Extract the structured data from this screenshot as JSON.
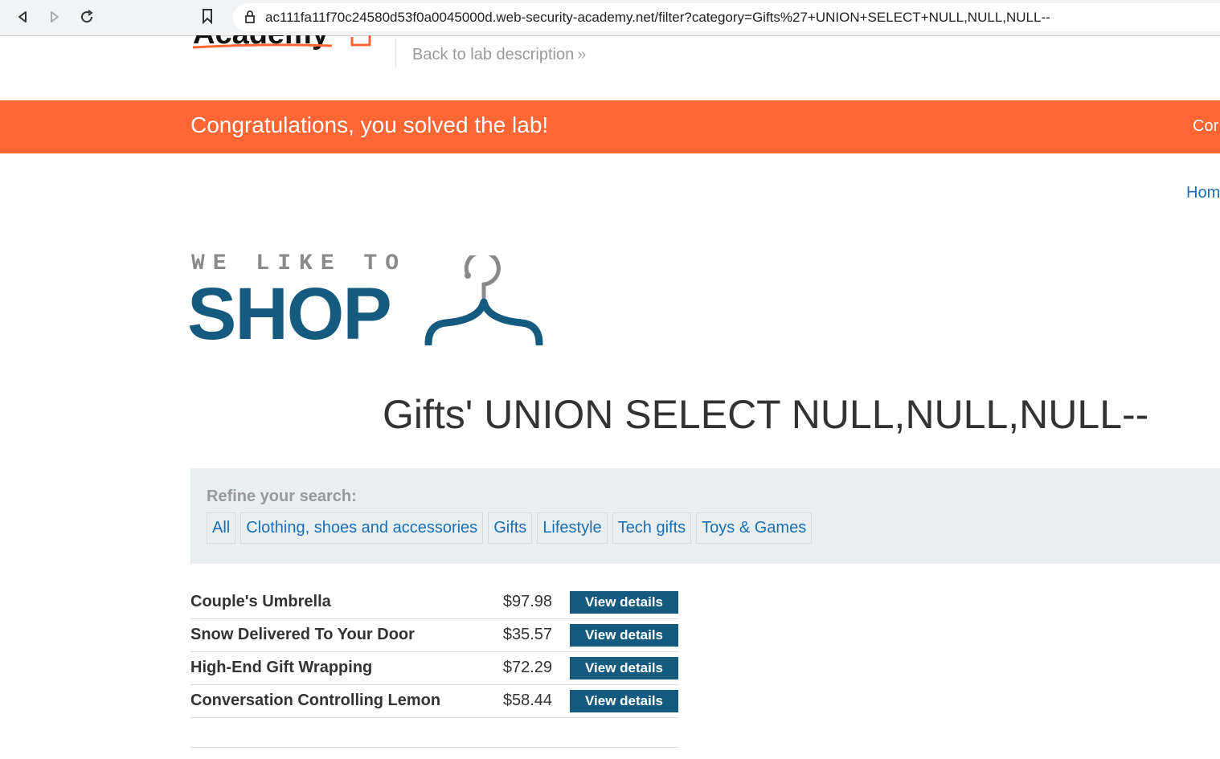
{
  "browser": {
    "url": "ac111fa11f70c24580d53f0a0045000d.web-security-academy.net/filter?category=Gifts%27+UNION+SELECT+NULL,NULL,NULL--"
  },
  "header": {
    "logo_text": "Academy",
    "back_link": "Back to lab description"
  },
  "banner": {
    "message": "Congratulations, you solved the lab!",
    "right_text": "Cor",
    "color": "#ff6633"
  },
  "nav": {
    "home": "Hom"
  },
  "shop_logo": {
    "tagline": "WE LIKE TO",
    "word": "SHOP"
  },
  "page_title": "Gifts' UNION SELECT NULL,NULL,NULL--",
  "filter": {
    "label": "Refine your search:",
    "categories": [
      "All",
      "Clothing, shoes and accessories",
      "Gifts",
      "Lifestyle",
      "Tech gifts",
      "Toys & Games"
    ]
  },
  "products": [
    {
      "name": "Couple's Umbrella",
      "price": "$97.98",
      "button": "View details"
    },
    {
      "name": "Snow Delivered To Your Door",
      "price": "$35.57",
      "button": "View details"
    },
    {
      "name": "High-End Gift Wrapping",
      "price": "$72.29",
      "button": "View details"
    },
    {
      "name": "Conversation Controlling Lemon",
      "price": "$58.44",
      "button": "View details"
    }
  ],
  "colors": {
    "brand_blue": "#155a7f",
    "link_blue": "#1a6eb4",
    "banner_orange": "#ff6633"
  }
}
